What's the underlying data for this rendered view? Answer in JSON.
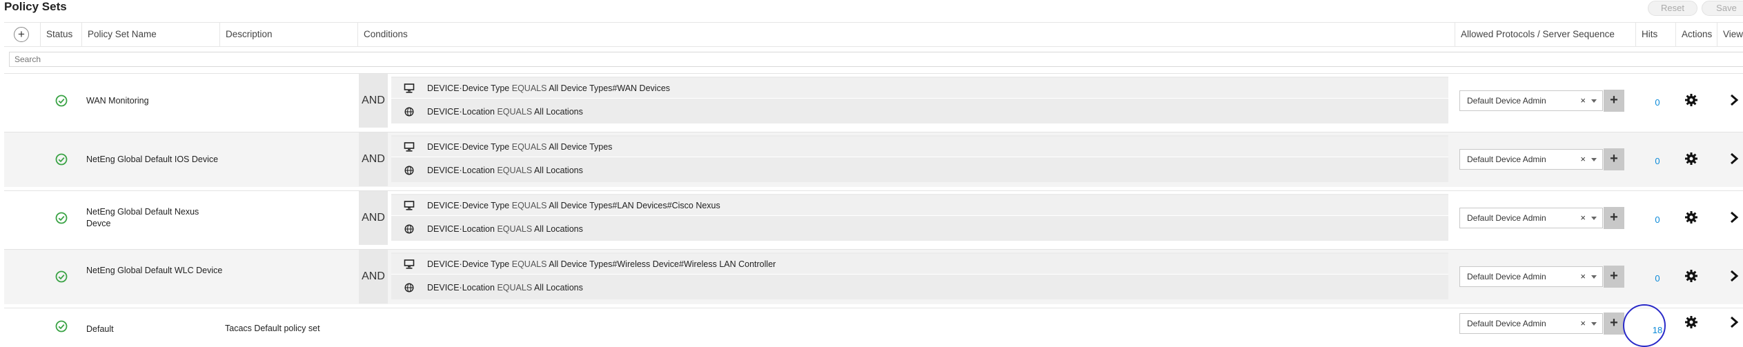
{
  "page": {
    "title": "Policy Sets"
  },
  "toolbar": {
    "reset_label": "Reset",
    "save_label": "Save"
  },
  "table": {
    "add_label": "+",
    "headers": {
      "status": "Status",
      "name": "Policy Set Name",
      "description": "Description",
      "conditions": "Conditions",
      "protocols": "Allowed Protocols / Server Sequence",
      "hits": "Hits",
      "actions": "Actions",
      "view": "View"
    },
    "search_placeholder": "Search",
    "rows": [
      {
        "name": "WAN Monitoring",
        "description": "",
        "operator": "AND",
        "conditions": [
          {
            "icon": "device-icon",
            "attr": "DEVICE·Device Type",
            "op": "EQUALS",
            "value": "All Device Types#WAN Devices"
          },
          {
            "icon": "globe-icon",
            "attr": "DEVICE·Location",
            "op": "EQUALS",
            "value": "All Locations"
          }
        ],
        "server_sequence": "Default Device Admin",
        "hits": "0"
      },
      {
        "name": "NetEng Global Default IOS Device",
        "description": "",
        "operator": "AND",
        "conditions": [
          {
            "icon": "device-icon",
            "attr": "DEVICE·Device Type",
            "op": "EQUALS",
            "value": "All Device Types"
          },
          {
            "icon": "globe-icon",
            "attr": "DEVICE·Location",
            "op": "EQUALS",
            "value": "All Locations"
          }
        ],
        "server_sequence": "Default Device Admin",
        "hits": "0"
      },
      {
        "name": "NetEng Global Default Nexus Devce",
        "description": "",
        "operator": "AND",
        "conditions": [
          {
            "icon": "device-icon",
            "attr": "DEVICE·Device Type",
            "op": "EQUALS",
            "value": "All Device Types#LAN Devices#Cisco Nexus"
          },
          {
            "icon": "globe-icon",
            "attr": "DEVICE·Location",
            "op": "EQUALS",
            "value": "All Locations"
          }
        ],
        "server_sequence": "Default Device Admin",
        "hits": "0"
      },
      {
        "name": "NetEng Global Default WLC Device",
        "description": "",
        "operator": "AND",
        "conditions": [
          {
            "icon": "device-icon",
            "attr": "DEVICE·Device Type",
            "op": "EQUALS",
            "value": "All Device Types#Wireless Device#Wireless LAN Controller"
          },
          {
            "icon": "globe-icon",
            "attr": "DEVICE·Location",
            "op": "EQUALS",
            "value": "All Locations"
          }
        ],
        "server_sequence": "Default Device Admin",
        "hits": "0"
      },
      {
        "name": "Default",
        "description": "Tacacs Default policy set",
        "operator": "",
        "conditions": [],
        "server_sequence": "Default Device Admin",
        "hits": "18"
      }
    ]
  },
  "colors": {
    "status_ok": "#3aa345",
    "hits_link": "#0b8ad9",
    "annotation_circle": "#2a2ac8"
  }
}
